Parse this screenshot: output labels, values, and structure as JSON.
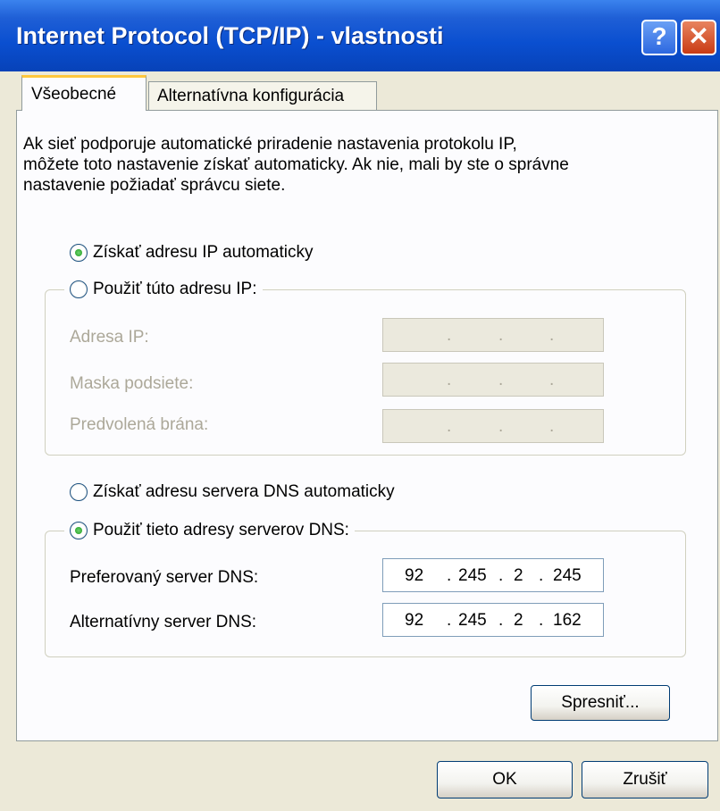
{
  "window": {
    "title": "Internet Protocol (TCP/IP) - vlastnosti",
    "help_label": "?",
    "close_label": "✕"
  },
  "tabs": [
    {
      "label": "Všeobecné",
      "active": true
    },
    {
      "label": "Alternatívna konfigurácia",
      "active": false
    }
  ],
  "intro": {
    "line1": "Ak sieť podporuje automatické priradenie nastavenia protokolu IP,",
    "line2": "môžete toto nastavenie získať automaticky. Ak nie, mali by ste o správne",
    "line3": "nastavenie požiadať správcu siete."
  },
  "ip": {
    "auto_label": "Získať adresu IP automaticky",
    "manual_label": "Použiť túto adresu IP:",
    "selected": "auto",
    "fields": [
      {
        "label": "Adresa IP:",
        "octets": [
          "",
          "",
          "",
          ""
        ],
        "dot": "."
      },
      {
        "label": "Maska podsiete:",
        "octets": [
          "",
          "",
          "",
          ""
        ],
        "dot": "."
      },
      {
        "label": "Predvolená brána:",
        "octets": [
          "",
          "",
          "",
          ""
        ],
        "dot": "."
      }
    ]
  },
  "dns": {
    "auto_label": "Získať adresu servera DNS automaticky",
    "manual_label": "Použiť tieto adresy serverov DNS:",
    "selected": "manual",
    "fields": [
      {
        "label": "Preferovaný server DNS:",
        "octets": [
          "92",
          "245",
          "2",
          "245"
        ],
        "dot": "."
      },
      {
        "label": "Alternatívny server DNS:",
        "octets": [
          "92",
          "245",
          "2",
          "162"
        ],
        "dot": "."
      }
    ]
  },
  "buttons": {
    "advanced": "Spresniť...",
    "ok": "OK",
    "cancel": "Zrušiť"
  },
  "colors": {
    "titlebar": "#0a4fd0",
    "radio_dot": "#1d9b1d",
    "tab_highlight": "#ffc73c"
  }
}
